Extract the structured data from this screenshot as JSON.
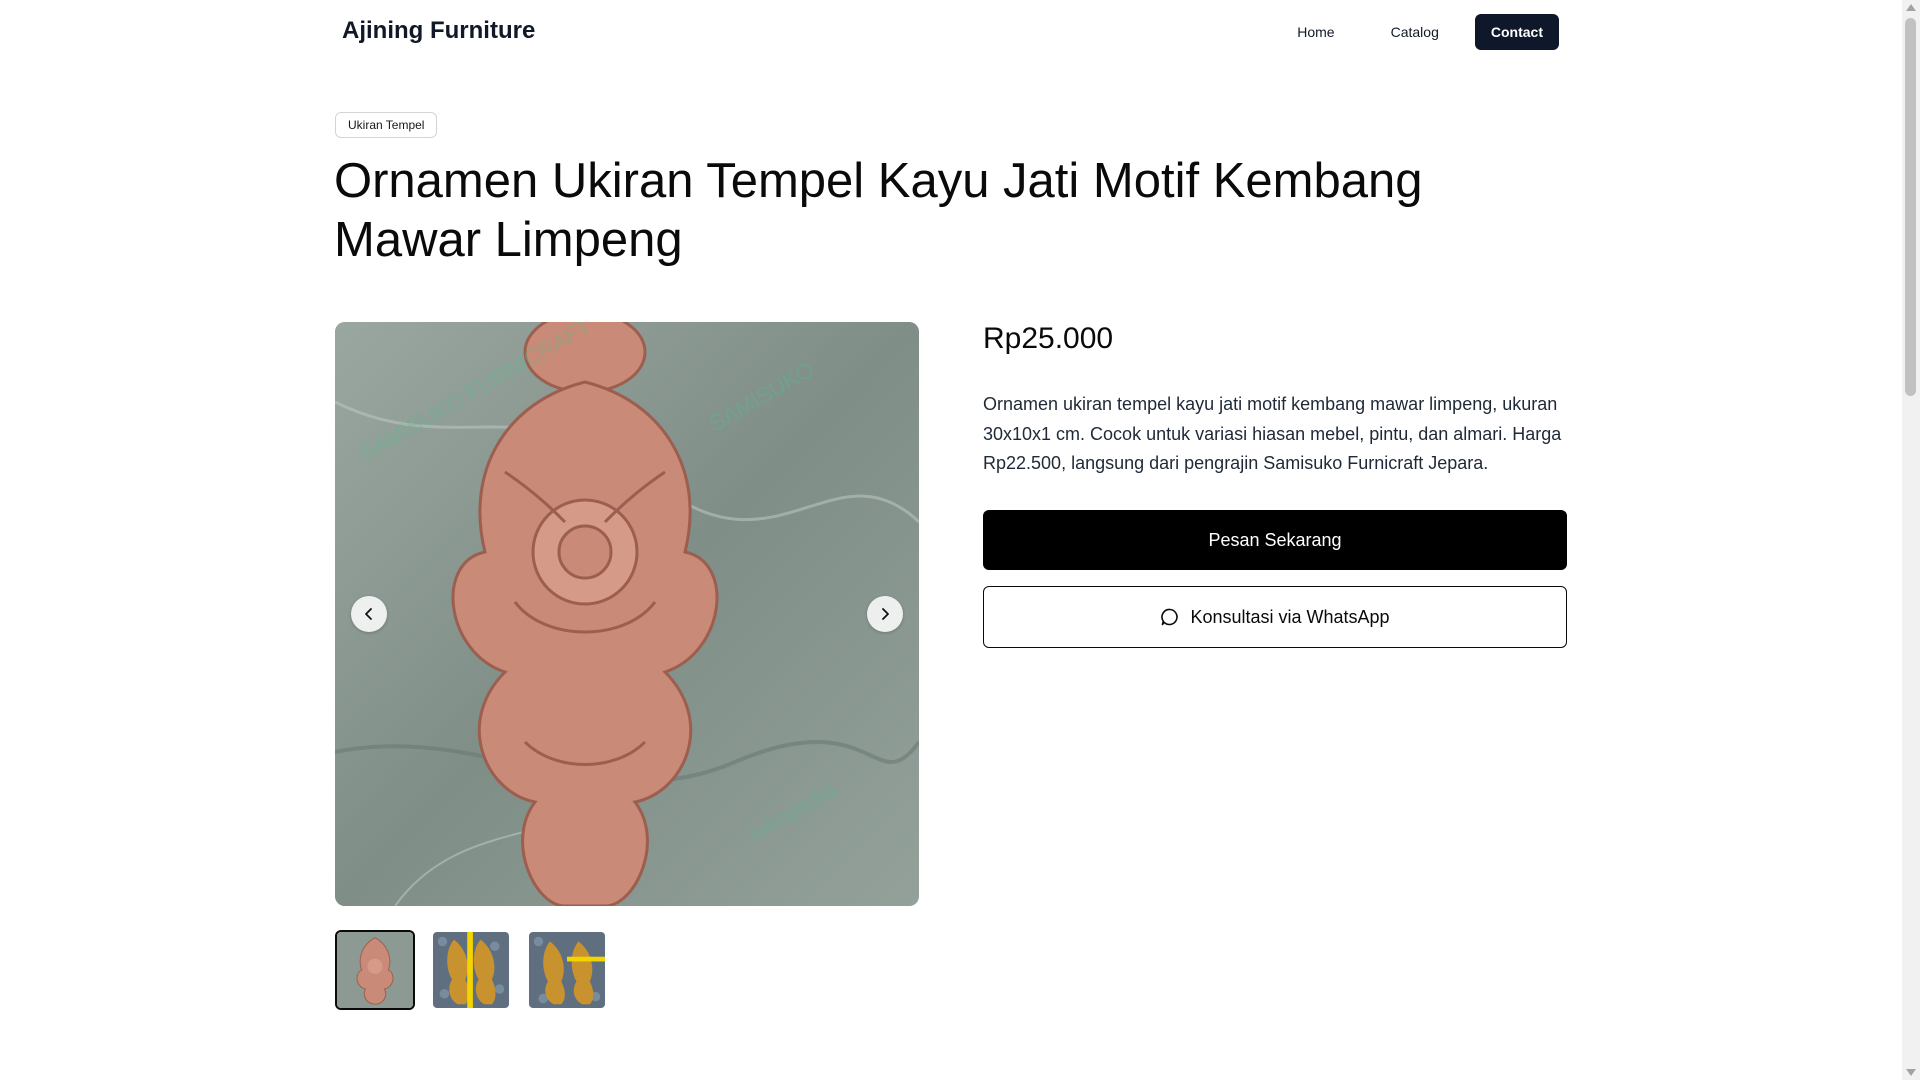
{
  "header": {
    "brand": "Ajining Furniture",
    "nav": {
      "home": "Home",
      "catalog": "Catalog",
      "contact": "Contact"
    }
  },
  "product": {
    "category_badge": "Ukiran Tempel",
    "title": "Ornamen Ukiran Tempel Kayu Jati Motif Kembang Mawar Limpeng",
    "price": "Rp25.000",
    "description": "Ornamen ukiran tempel kayu jati motif kembang mawar limpeng, ukuran 30x10x1 cm. Cocok untuk variasi hiasan mebel, pintu, dan almari. Harga Rp22.500, langsung dari pengrajin Samisuko Furnicraft Jepara.",
    "order_button": "Pesan Sekarang",
    "whatsapp_button": "Konsultasi via WhatsApp"
  },
  "gallery": {
    "active_index": 0,
    "thumbnail_count": 3
  },
  "colors": {
    "primary": "#000000",
    "nav_contact_bg": "#0f172a",
    "carving": "#c98a78",
    "marble": "#8c9a93"
  }
}
